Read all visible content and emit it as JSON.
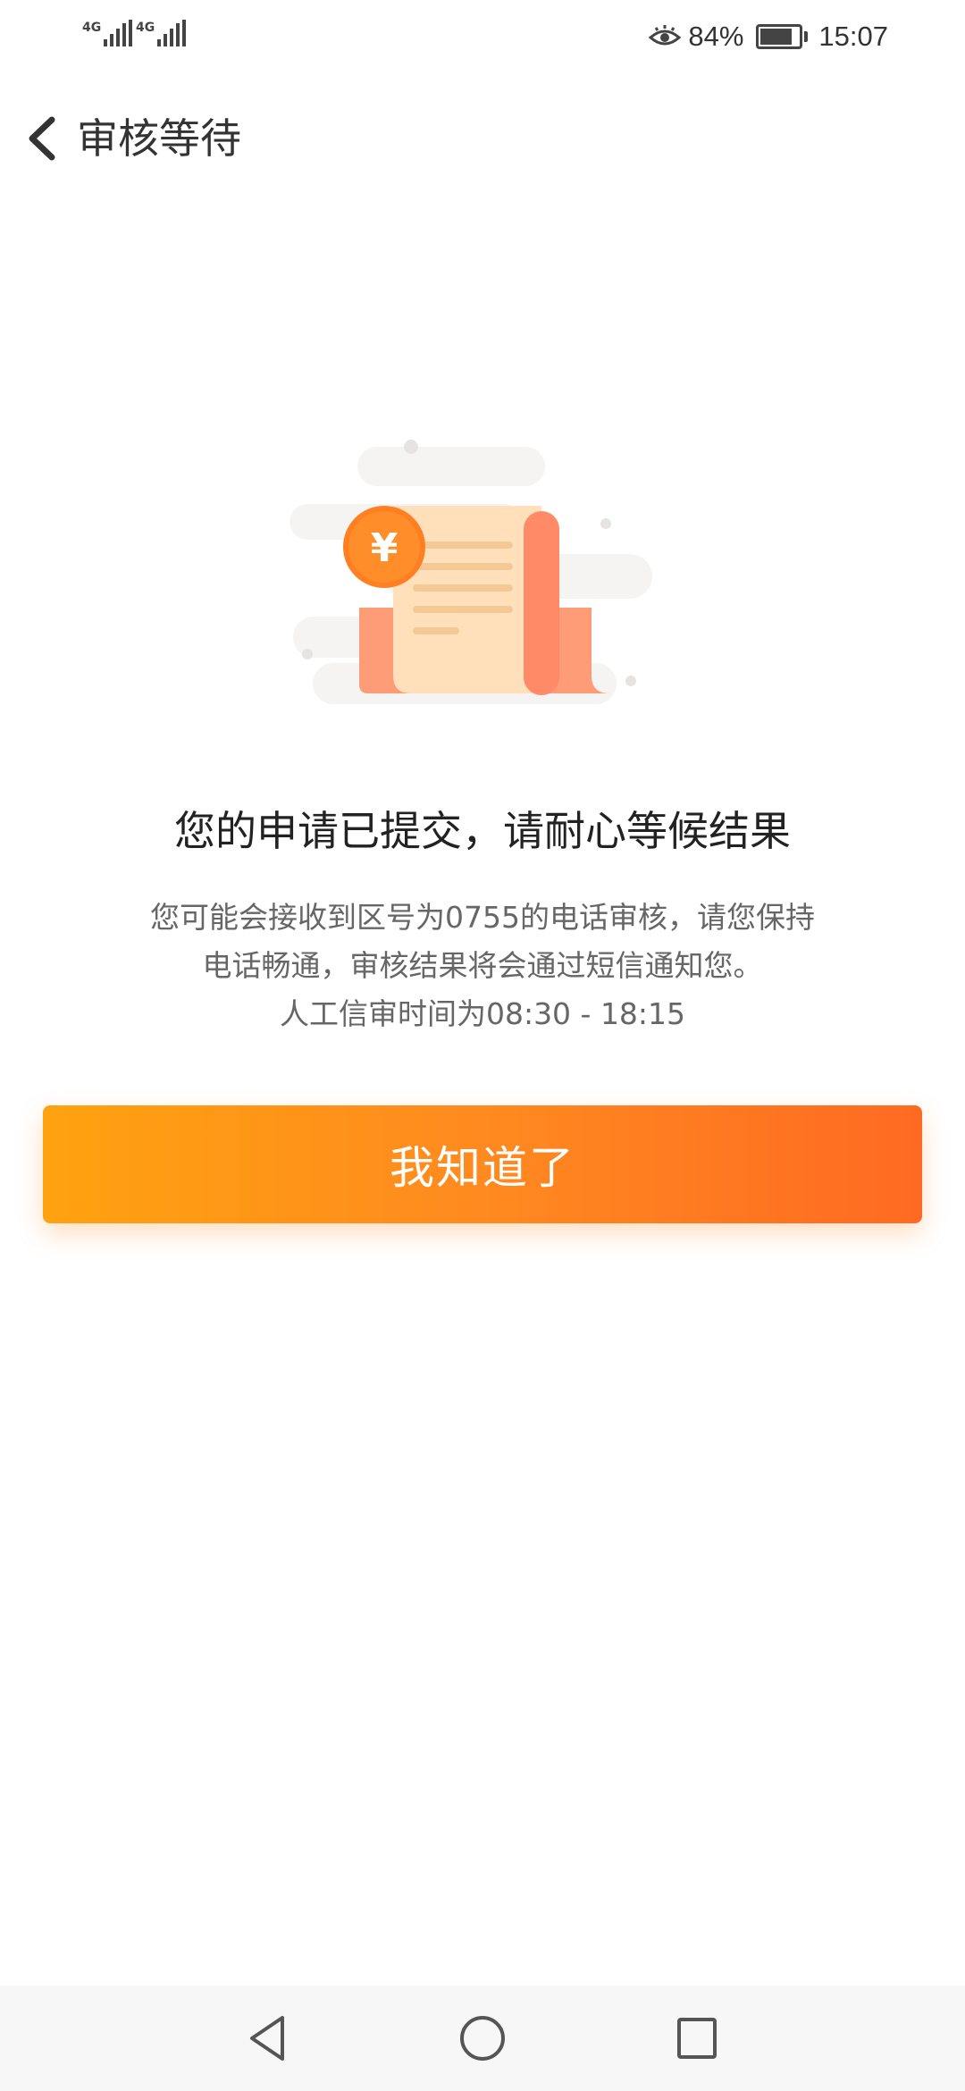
{
  "status_bar": {
    "network_1": "4G",
    "network_2": "4G",
    "battery_percent": "84%",
    "battery_level": 0.84,
    "time": "15:07"
  },
  "header": {
    "title": "审核等待"
  },
  "illustration": {
    "icon": "bill-receipt-with-yen-coin",
    "coin_symbol": "¥",
    "colors": {
      "coin": "#ff8a2a",
      "paper": "#ffe3c0",
      "paper_roll": "#ff8d6a",
      "cloud": "#f5f3f1"
    }
  },
  "result": {
    "title": "您的申请已提交，请耐心等候结果",
    "desc_lines": [
      "您可能会接收到区号为0755的电话审核，请您保持",
      "电话畅通，审核结果将会通过短信通知您。",
      "人工信审时间为08:30 - 18:15"
    ]
  },
  "actions": {
    "confirm_label": "我知道了"
  },
  "nav_bar": {
    "back": "back-triangle-icon",
    "home": "home-circle-icon",
    "recents": "recents-square-icon"
  },
  "colors": {
    "accent_start": "#ffa20f",
    "accent_end": "#ff6a22",
    "title_text": "#222222",
    "body_text": "#666666"
  }
}
